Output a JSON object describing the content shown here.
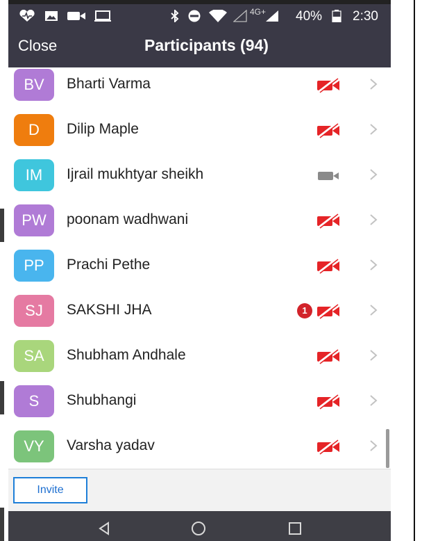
{
  "status_bar": {
    "network_label": "4G+",
    "battery_percent": "40%",
    "time": "2:30",
    "icons": [
      "heart-icon",
      "gallery-icon",
      "video-icon",
      "monitor-icon",
      "bluetooth-icon",
      "do-not-disturb-icon",
      "wifi-icon",
      "signal-icon",
      "battery-icon"
    ]
  },
  "header": {
    "close_label": "Close",
    "title": "Participants (94)"
  },
  "participants": [
    {
      "initials": "BV",
      "name": "Bharti Varma",
      "avatar_color": "#b07bd6",
      "video": "off"
    },
    {
      "initials": "D",
      "name": "Dilip Maple",
      "avatar_color": "#ef7d0e",
      "video": "off"
    },
    {
      "initials": "IM",
      "name": "Ijrail mukhtyar sheikh",
      "avatar_color": "#3fc6dd",
      "video": "on"
    },
    {
      "initials": "PW",
      "name": "poonam wadhwani",
      "avatar_color": "#b07bd6",
      "video": "off"
    },
    {
      "initials": "PP",
      "name": "Prachi Pethe",
      "avatar_color": "#49b5ee",
      "video": "off"
    },
    {
      "initials": "SJ",
      "name": "SAKSHI JHA",
      "avatar_color": "#e57aa2",
      "video": "off",
      "badge": "1"
    },
    {
      "initials": "SA",
      "name": "Shubham Andhale",
      "avatar_color": "#a9d67c",
      "video": "off"
    },
    {
      "initials": "S",
      "name": "Shubhangi",
      "avatar_color": "#b07bd6",
      "video": "off"
    },
    {
      "initials": "VY",
      "name": "Varsha yadav",
      "avatar_color": "#7cc47b",
      "video": "off"
    }
  ],
  "footer": {
    "invite_label": "Invite"
  },
  "colors": {
    "header_bg": "#3a3946",
    "video_off": "#e52427",
    "video_on": "#8a8a8a",
    "invite_accent": "#1e7fd8"
  }
}
